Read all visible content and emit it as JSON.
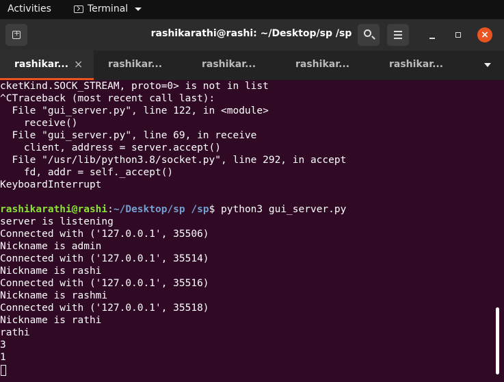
{
  "topbar": {
    "activities": "Activities",
    "app_name": "Terminal"
  },
  "window": {
    "title": "rashikarathi@rashi: ~/Desktop/sp /sp"
  },
  "tabs": [
    {
      "label": "rashikar...",
      "active": true
    },
    {
      "label": "rashikar...",
      "active": false
    },
    {
      "label": "rashikar...",
      "active": false
    },
    {
      "label": "rashikar...",
      "active": false
    },
    {
      "label": "rashikar...",
      "active": false
    }
  ],
  "tab_close_glyph": "×",
  "terminal": {
    "lines_before": [
      "cketKind.SOCK_STREAM, proto=0> is not in list",
      "^CTraceback (most recent call last):",
      "  File \"gui_server.py\", line 122, in <module>",
      "    receive()",
      "  File \"gui_server.py\", line 69, in receive",
      "    client, address = server.accept()",
      "  File \"/usr/lib/python3.8/socket.py\", line 292, in accept",
      "    fd, addr = self._accept()",
      "KeyboardInterrupt",
      ""
    ],
    "prompt": {
      "user_host": "rashikarathi@rashi",
      "sep": ":",
      "path": "~/Desktop/sp /sp",
      "symbol": "$ ",
      "command": "python3 gui_server.py"
    },
    "lines_after": [
      "server is listening",
      "Connected with ('127.0.0.1', 35506)",
      "Nickname is admin",
      "Connected with ('127.0.0.1', 35514)",
      "Nickname is rashi",
      "Connected with ('127.0.0.1', 35516)",
      "Nickname is rashmi",
      "Connected with ('127.0.0.1', 35518)",
      "Nickname is rathi",
      "rathi",
      "3",
      "1"
    ]
  },
  "colors": {
    "background": "#300a24",
    "accent": "#e95420",
    "user": "#8ae234",
    "path": "#729fcf"
  }
}
